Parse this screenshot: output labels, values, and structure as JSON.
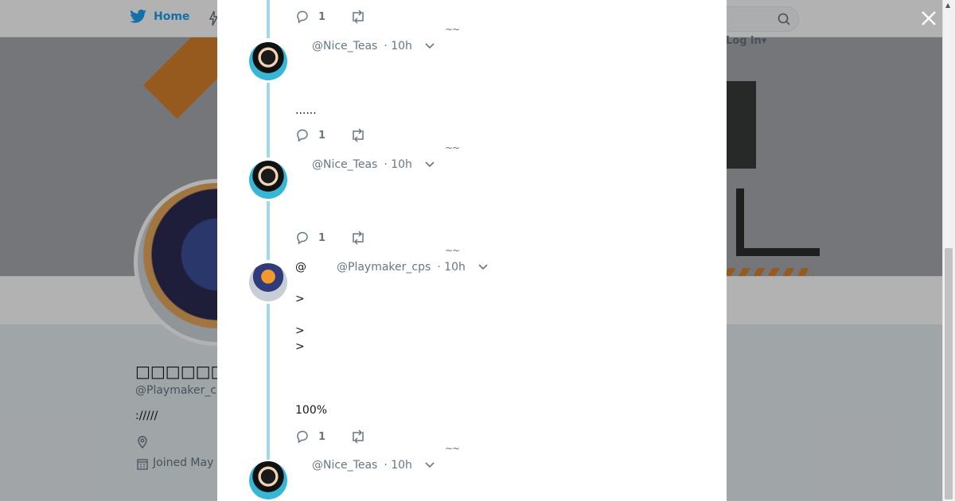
{
  "background": {
    "nav": {
      "home_label": "Home",
      "login_label": "Log in"
    },
    "profile": {
      "name": "□□□□□□□@",
      "handle": "@Playmaker_c",
      "bio": "://///",
      "joined": "Joined May"
    }
  },
  "modal": {
    "tweets": [
      {
        "type": "actions-only",
        "reply_count": "1"
      },
      {
        "handle": "@Nice_Teas",
        "time": "· 10h",
        "text": "......",
        "reply_count": "1",
        "avatar": "nice-teas"
      },
      {
        "handle": "@Nice_Teas",
        "time": "· 10h",
        "text": "",
        "reply_count": "1",
        "avatar": "nice-teas"
      },
      {
        "prefix": "@",
        "handle": "@Playmaker_cps",
        "time": "· 10h",
        "lines": [
          ">",
          ">",
          ">",
          "100%"
        ],
        "reply_count": "1",
        "avatar": "playmaker"
      },
      {
        "handle": "@Nice_Teas",
        "time": "· 10h",
        "avatar": "nice-teas"
      }
    ],
    "tilde": "~~"
  },
  "colors": {
    "accent": "#1da1f2",
    "thread_line": "#a2d7f2",
    "muted": "#657786"
  }
}
